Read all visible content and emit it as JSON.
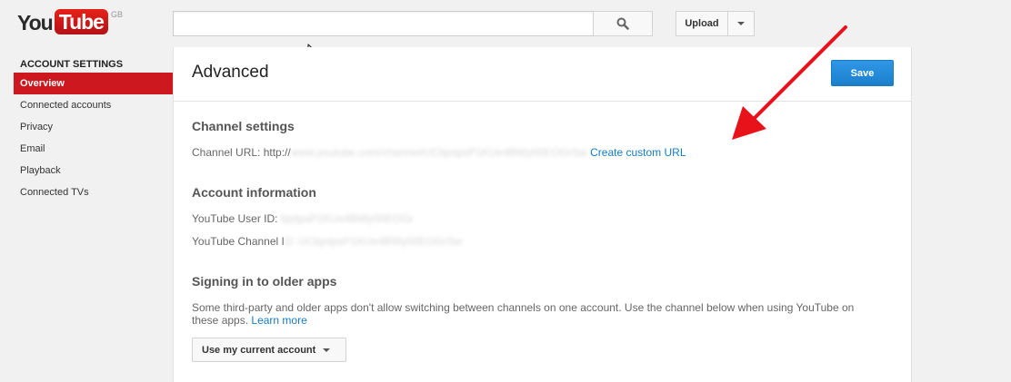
{
  "header": {
    "logo_you": "You",
    "logo_tube": "Tube",
    "logo_region": "GB",
    "search_placeholder": "",
    "upload_label": "Upload"
  },
  "sidebar": {
    "heading": "ACCOUNT SETTINGS",
    "items": [
      {
        "label": "Overview",
        "active": true
      },
      {
        "label": "Connected accounts",
        "active": false
      },
      {
        "label": "Privacy",
        "active": false
      },
      {
        "label": "Email",
        "active": false
      },
      {
        "label": "Playback",
        "active": false
      },
      {
        "label": "Connected TVs",
        "active": false
      }
    ]
  },
  "main": {
    "title": "Advanced",
    "save_label": "Save",
    "channel_settings": {
      "title": "Channel settings",
      "url_label": "Channel URL: http://",
      "url_value_blurred": "www.youtube.com/channel/UCbjotpsP1KUe4BWy00EOGrSw",
      "create_custom_url": "Create custom URL"
    },
    "account_info": {
      "title": "Account information",
      "user_id_label": "YouTube User ID:",
      "user_id_blurred": "bjotpsP1KUe4BWy00EOGr",
      "channel_label": "YouTube Channel I",
      "channel_blurred": "D: UCbjotpsP1KUe4BWy00EOGrSw"
    },
    "older_apps": {
      "title": "Signing in to older apps",
      "description": "Some third-party and older apps don't allow switching between channels on one account. Use the channel below when using YouTube on these apps.",
      "learn_more": "Learn more",
      "account_select": "Use my current account"
    }
  },
  "colors": {
    "brand_red": "#cc181e",
    "link_blue": "#167ac6",
    "save_blue": "#2793e6",
    "annotation_arrow": "#e8121a"
  }
}
